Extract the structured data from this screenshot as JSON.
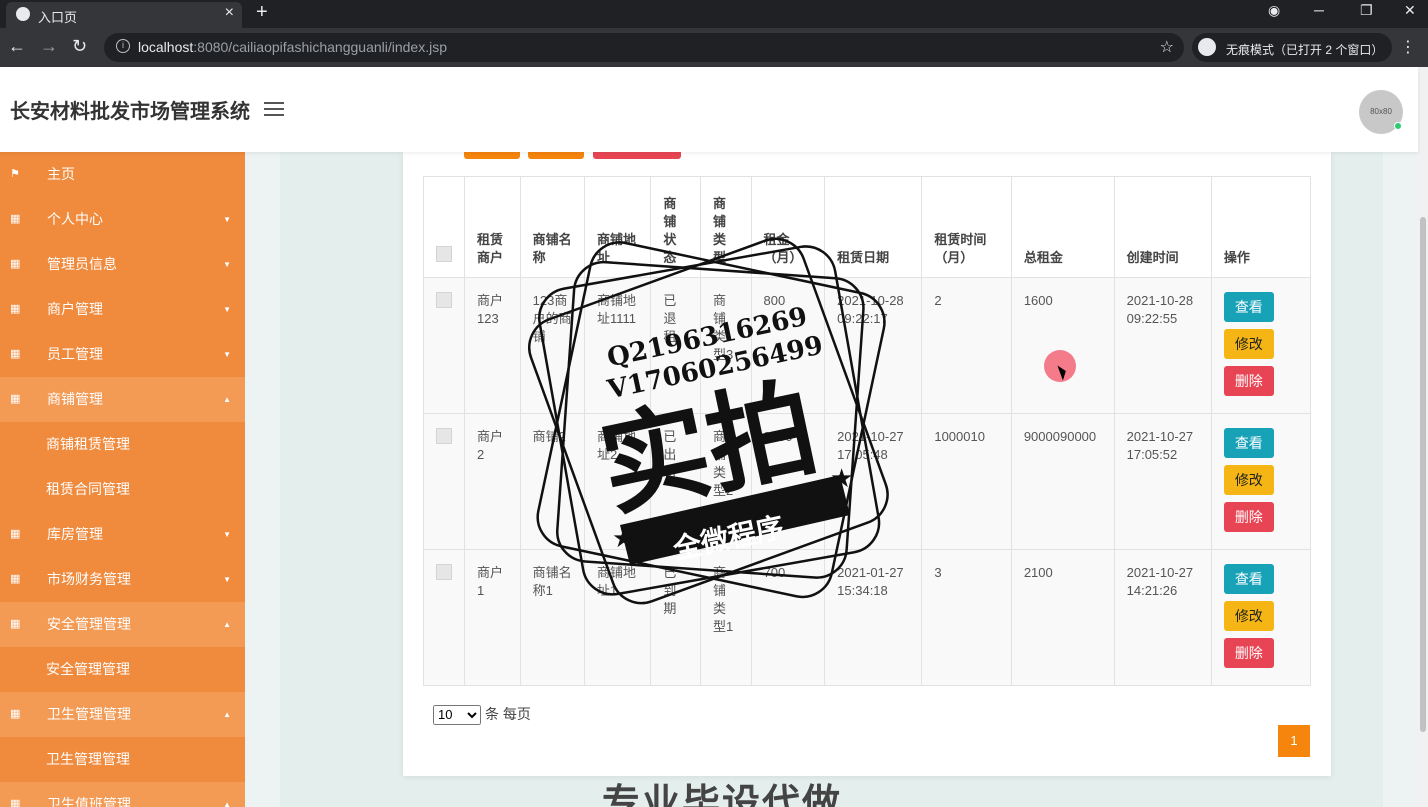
{
  "browser": {
    "tab_title": "入口页",
    "url_host": "localhost",
    "url_rest": ":8080/cailiaopifashichangguanli/index.jsp",
    "incognito": "无痕模式（已打开 2 个窗口）"
  },
  "header": {
    "title": "长安材料批发市场管理系统",
    "avatar_text": "80x80"
  },
  "sidebar": {
    "items": [
      {
        "label": "主页",
        "icon": "flag-icon",
        "caret": ""
      },
      {
        "label": "个人中心",
        "icon": "grid-icon",
        "caret": "▼"
      },
      {
        "label": "管理员信息",
        "icon": "grid-icon",
        "caret": "▼"
      },
      {
        "label": "商户管理",
        "icon": "grid-icon",
        "caret": "▼"
      },
      {
        "label": "员工管理",
        "icon": "grid-icon",
        "caret": "▼"
      },
      {
        "label": "商铺管理",
        "icon": "grid-icon",
        "caret": "▲",
        "open": true
      },
      {
        "label": "商铺租赁管理",
        "sub": true
      },
      {
        "label": "租赁合同管理",
        "sub": true
      },
      {
        "label": "库房管理",
        "icon": "grid-icon",
        "caret": "▼"
      },
      {
        "label": "市场财务管理",
        "icon": "grid-icon",
        "caret": "▼"
      },
      {
        "label": "安全管理管理",
        "icon": "grid-icon",
        "caret": "▲",
        "open": true
      },
      {
        "label": "安全管理管理",
        "sub": true
      },
      {
        "label": "卫生管理管理",
        "icon": "grid-icon",
        "caret": "▲",
        "open": true
      },
      {
        "label": "卫生管理管理",
        "sub": true
      },
      {
        "label": "卫生值班管理",
        "icon": "grid-icon",
        "caret": "▲",
        "open": true
      }
    ]
  },
  "table": {
    "headers": [
      "租赁商户",
      "商铺名称",
      "商铺地址",
      "商铺状态",
      "商铺类型",
      "租金（月）",
      "租赁日期",
      "租赁时间（月）",
      "总租金",
      "创建时间",
      "操作"
    ],
    "rows": [
      [
        "商户123",
        "123商户的商铺",
        "商铺地址1111",
        "已退租",
        "商铺类型3",
        "800",
        "2021-10-28 09:22:17",
        "2",
        "1600",
        "2021-10-28 09:22:55"
      ],
      [
        "商户2",
        "商铺2",
        "商铺地址2",
        "已出租",
        "商铺类型2",
        "9000",
        "2021-10-27 17:05:48",
        "1000010",
        "9000090000",
        "2021-10-27 17:05:52"
      ],
      [
        "商户1",
        "商铺名称1",
        "商铺地址1",
        "已到期",
        "商铺类型1",
        "700",
        "2021-01-27 15:34:18",
        "3",
        "2100",
        "2021-10-27 14:21:26"
      ]
    ],
    "actions": {
      "view": "查看",
      "edit": "修改",
      "delete": "删除"
    }
  },
  "pager": {
    "page_size": "10",
    "size_suffix": "条 每页",
    "current_page": "1"
  },
  "watermark": {
    "line1": "Q2196316269",
    "line2": "V17060256499",
    "main": "实拍",
    "banner": "全微程序"
  },
  "bottom_text": "专业毕设代做",
  "colors": {
    "sidebar": "#f08a3c",
    "view_button": "#17a2b8",
    "edit_button": "#f5b514",
    "delete_button": "#e84554",
    "page_active": "#f5850d"
  }
}
